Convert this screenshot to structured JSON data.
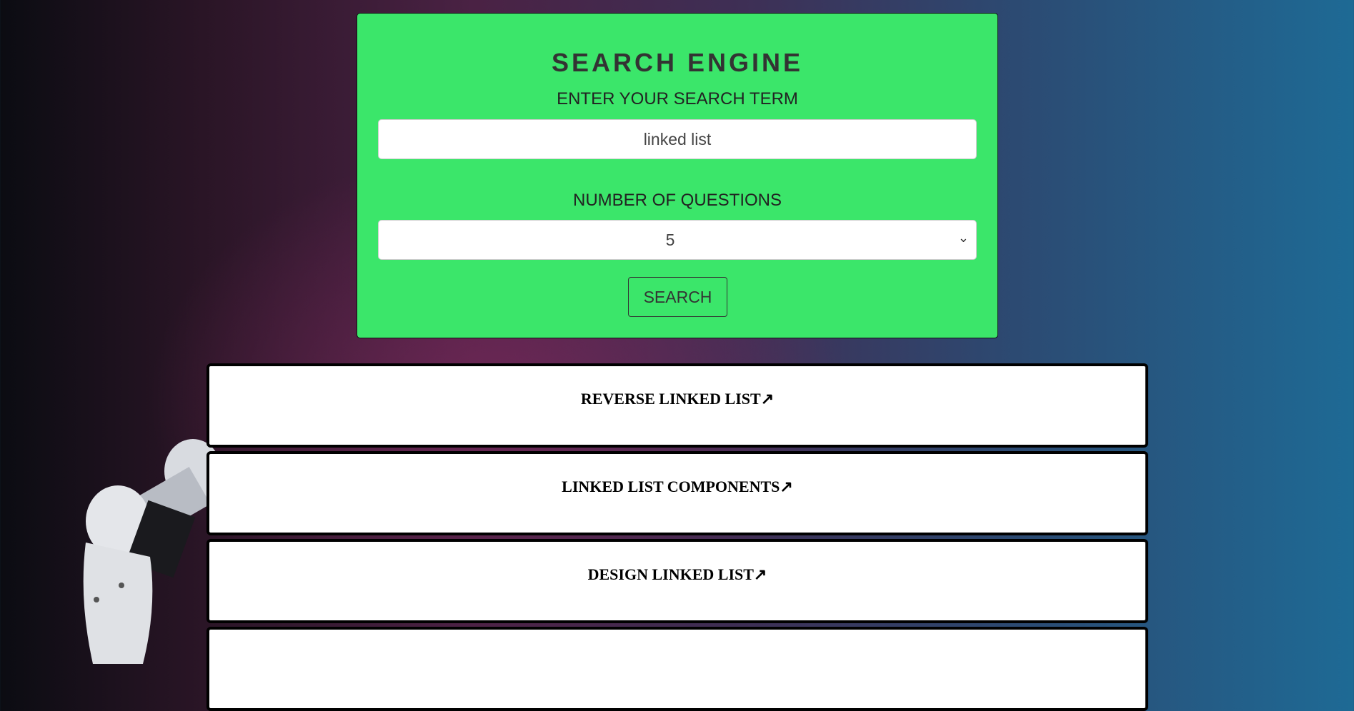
{
  "search_panel": {
    "title": "SEARCH ENGINE",
    "term_label": "ENTER YOUR SEARCH TERM",
    "term_value": "linked list",
    "count_label": "NUMBER OF QUESTIONS",
    "count_value": "5",
    "search_button": "SEARCH",
    "accent_color": "#3be66a"
  },
  "results": [
    {
      "title": "REVERSE LINKED LIST↗"
    },
    {
      "title": "LINKED LIST COMPONENTS↗"
    },
    {
      "title": "DESIGN LINKED LIST↗"
    },
    {
      "title": ""
    }
  ]
}
